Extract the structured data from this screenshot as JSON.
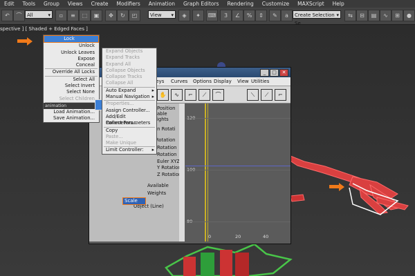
{
  "menubar": [
    "Edit",
    "Tools",
    "Group",
    "Views",
    "Create",
    "Modifiers",
    "Animation",
    "Graph Editors",
    "Rendering",
    "Customize",
    "MAXScript",
    "Help"
  ],
  "toolbar": {
    "filter_value": "All",
    "view_value": "View",
    "selection_set_placeholder": "Create Selection Se"
  },
  "viewport": {
    "label": "spective ] [ Shaded + Edged Faces ]"
  },
  "left_menu": {
    "items": [
      {
        "label": "Lock",
        "highlighted": true
      },
      {
        "label": "Unlock"
      },
      {
        "label": "Unlock Leaves"
      },
      {
        "label": "Expose"
      },
      {
        "label": "Conceal"
      },
      {
        "label": "Override All Locks"
      },
      {
        "label": "Select All"
      },
      {
        "label": "Select Invert"
      },
      {
        "label": "Select None"
      },
      {
        "label": "Select Children",
        "disabled": true
      },
      {
        "label": "animation"
      },
      {
        "label": "controllers"
      },
      {
        "label": "Load Animation..."
      },
      {
        "label": "Save Animation..."
      }
    ]
  },
  "mid_menu": {
    "items": [
      {
        "label": "Expand Objects",
        "disabled": true
      },
      {
        "label": "Expand Tracks",
        "disabled": true
      },
      {
        "label": "Expand All",
        "disabled": true
      },
      {
        "label": "Collapse Objects",
        "disabled": true
      },
      {
        "label": "Collapse Tracks",
        "disabled": true
      },
      {
        "label": "Collapse All",
        "disabled": true
      },
      {
        "label": "Auto Expand",
        "submenu": true
      },
      {
        "label": "Manual Navigation",
        "submenu": true
      },
      {
        "label": "Properties...",
        "disabled": true
      },
      {
        "label": "Assign Controller..."
      },
      {
        "label": "Add/Edit Parameters..."
      },
      {
        "label": "Collect Parameters"
      },
      {
        "label": "Copy"
      },
      {
        "label": "Paste...",
        "disabled": true
      },
      {
        "label": "Make Unique",
        "disabled": true
      },
      {
        "label": "Limit Controller:",
        "submenu": true
      }
    ]
  },
  "graph_editor": {
    "menu": [
      "Keys",
      "Curves",
      "Options",
      "Display",
      "View",
      "Utilities"
    ],
    "tree_items": [
      "Position",
      "able",
      "ights",
      "en Rotati",
      "Rotation",
      "Rotation",
      "Rotation",
      "Euler XYZ",
      "Y Rotation",
      "Z Rotation",
      "Available",
      "Weights",
      "Scale",
      "Object (Line)"
    ],
    "selected_item": "Scale",
    "y_ticks": [
      "120",
      "100",
      "80"
    ],
    "x_ticks": [
      "0",
      "20",
      "40"
    ]
  },
  "colors": {
    "accent_orange": "#f07a1a",
    "highlight_blue": "#2f62b5"
  }
}
